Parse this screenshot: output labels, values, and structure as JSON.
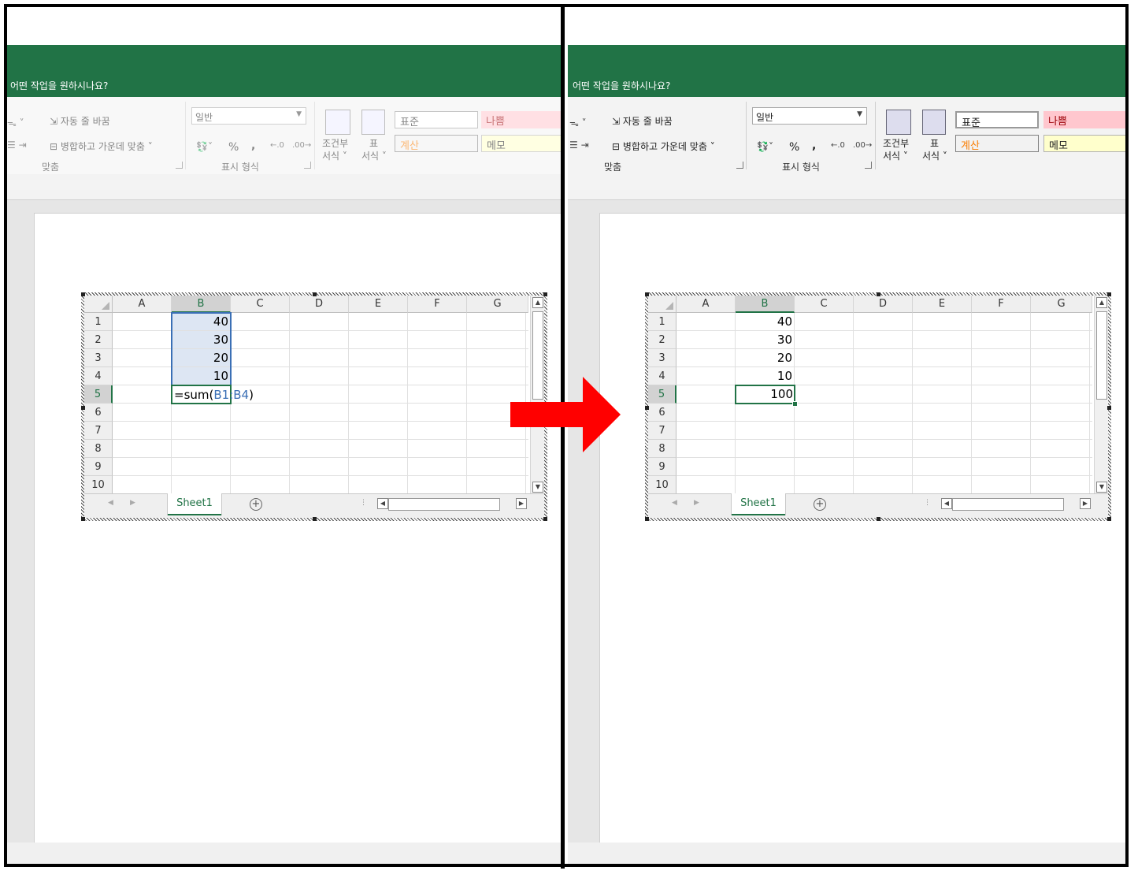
{
  "left": {
    "tell_me": "어떤 작업을 원하시나요?",
    "ribbon": {
      "wrap_text": "자동 줄 바꿈",
      "merge_center": "병합하고 가운데 맞춤",
      "align_group": "맞춤",
      "number_format_value": "일반",
      "percent": "%",
      "comma": ",",
      "number_group": "표시 형식",
      "cond_format_1": "조건부",
      "cond_format_2": "서식",
      "table_format_1": "표",
      "table_format_2": "서식",
      "style_normal": "표준",
      "style_bad": "나쁨",
      "style_calc": "계산",
      "style_memo": "메모"
    },
    "columns": [
      "A",
      "B",
      "C",
      "D",
      "E",
      "F",
      "G"
    ],
    "rows": [
      "1",
      "2",
      "3",
      "4",
      "5",
      "6",
      "7",
      "8",
      "9",
      "10"
    ],
    "cells_b": [
      "40",
      "30",
      "20",
      "10"
    ],
    "formula_prefix": "=sum(",
    "formula_ref": "B1:B4",
    "formula_suffix": ")",
    "sheet_tab": "Sheet1"
  },
  "right": {
    "tell_me": "어떤 작업을 원하시나요?",
    "ribbon": {
      "wrap_text": "자동 줄 바꿈",
      "merge_center": "병합하고 가운데 맞춤",
      "align_group": "맞춤",
      "number_format_value": "일반",
      "percent": "%",
      "comma": ",",
      "number_group": "표시 형식",
      "cond_format_1": "조건부",
      "cond_format_2": "서식",
      "table_format_1": "표",
      "table_format_2": "서식",
      "style_normal": "표준",
      "style_bad": "나쁨",
      "style_calc": "계산",
      "style_memo": "메모"
    },
    "columns": [
      "A",
      "B",
      "C",
      "D",
      "E",
      "F",
      "G"
    ],
    "rows": [
      "1",
      "2",
      "3",
      "4",
      "5",
      "6",
      "7",
      "8",
      "9",
      "10"
    ],
    "cells_b": [
      "40",
      "30",
      "20",
      "10"
    ],
    "result": "100",
    "sheet_tab": "Sheet1"
  },
  "colors": {
    "excel_green": "#217346",
    "arrow_red": "#ff0000",
    "style_bad_bg": "#ffc7ce",
    "style_bad_fg": "#9c0006",
    "style_calc_fg": "#fa7d00",
    "style_memo_bg": "#ffffcc"
  }
}
